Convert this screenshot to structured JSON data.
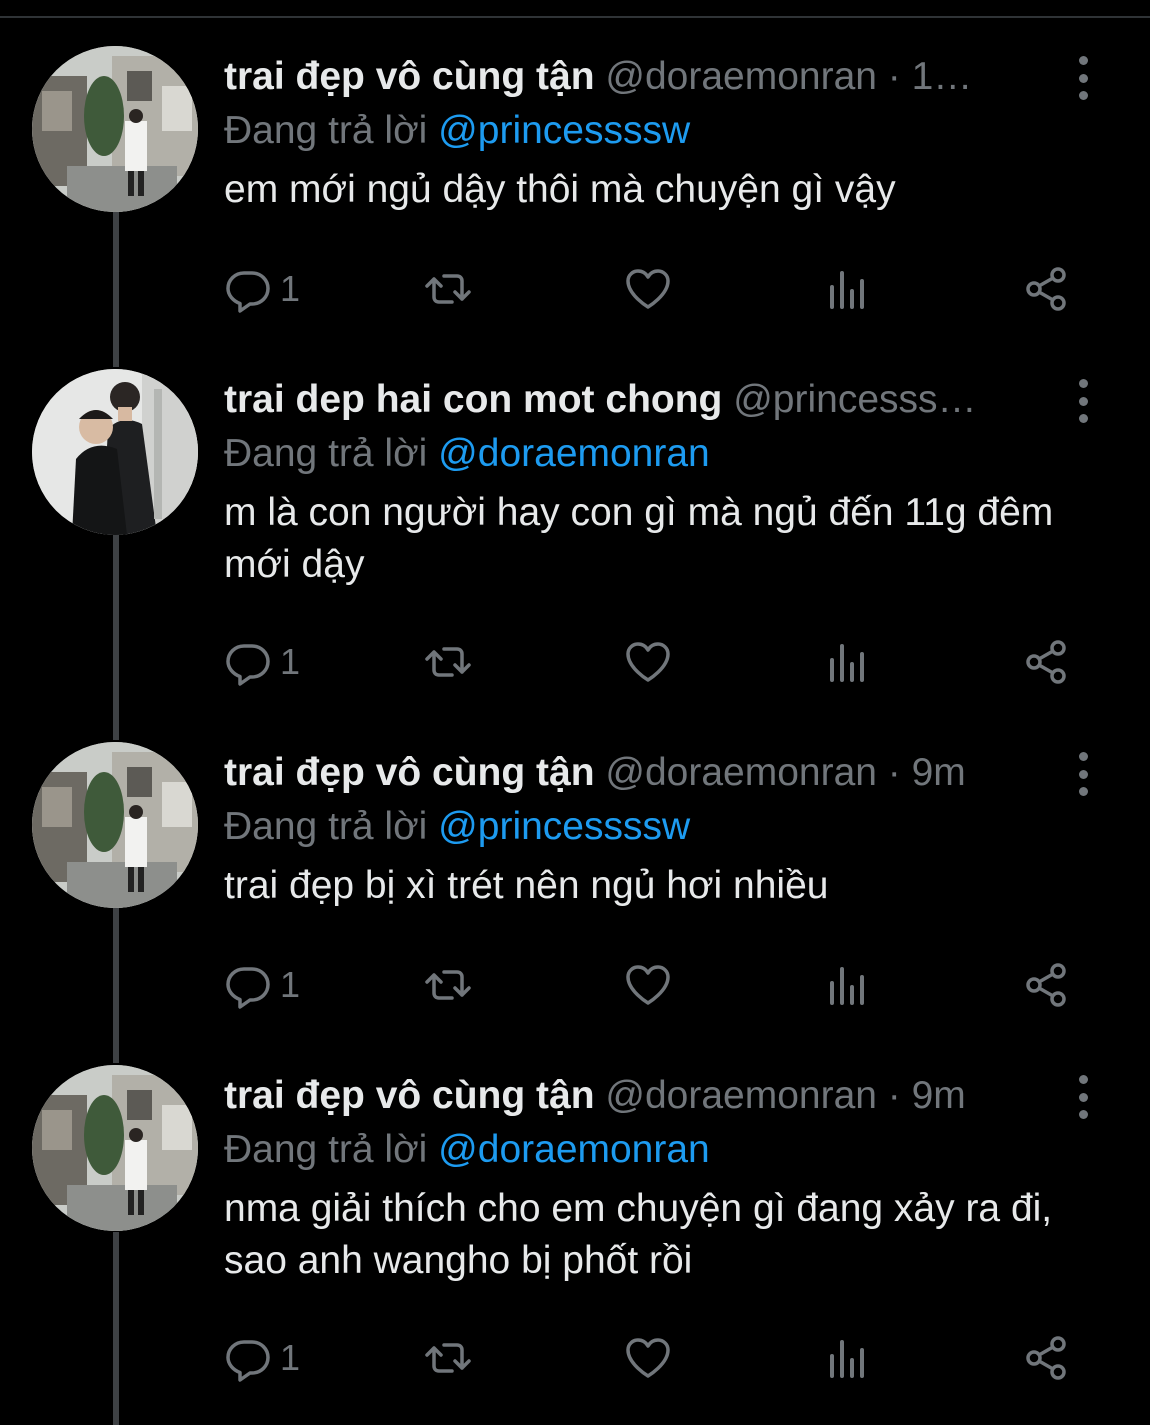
{
  "tweets": [
    {
      "name": "trai đẹp vô cùng tận",
      "handle": "@doraemonran · 1…",
      "reply_prefix": "Đang trả lời",
      "reply_to": "@princessssw",
      "text": "em mới ngủ dậy thôi mà chuyện gì vậy",
      "reply_count": "1",
      "avatar": "street-photo-avatar"
    },
    {
      "name": "trai dep hai con mot chong",
      "handle": "@princesss…",
      "reply_prefix": "Đang trả lời",
      "reply_to": "@doraemonran",
      "text": "m là con người hay con gì mà ngủ đến 11g đêm mới dậy",
      "reply_count": "1",
      "avatar": "two-men-photo-avatar"
    },
    {
      "name": "trai đẹp vô cùng tận",
      "handle": "@doraemonran · 9m",
      "reply_prefix": "Đang trả lời",
      "reply_to": "@princessssw",
      "text": "trai đẹp bị xì trét nên ngủ hơi nhiều",
      "reply_count": "1",
      "avatar": "street-photo-avatar"
    },
    {
      "name": "trai đẹp vô cùng tận",
      "handle": "@doraemonran · 9m",
      "reply_prefix": "Đang trả lời",
      "reply_to": "@doraemonran",
      "text": "nma giải thích cho em chuyện gì đang xảy ra đi, sao anh wangho bị phốt rồi",
      "reply_count": "1",
      "avatar": "street-photo-avatar"
    }
  ],
  "colors": {
    "background": "#000000",
    "text": "#e7e9ea",
    "muted": "#71767b",
    "link": "#1d9bf0",
    "thread_line": "#3e4144"
  }
}
